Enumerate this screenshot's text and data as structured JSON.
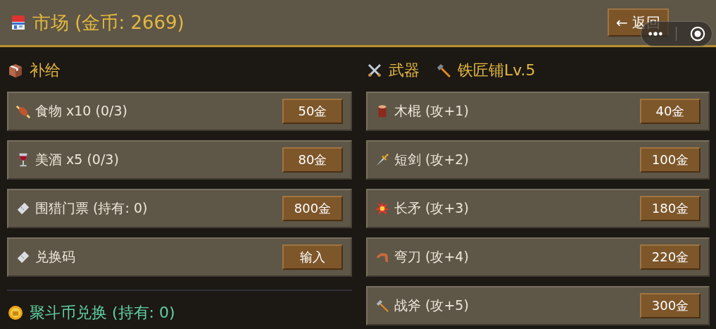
{
  "header": {
    "title": "市场 (金币: 2669)",
    "back_button": "← 返回"
  },
  "supplies": {
    "title": "补给",
    "items": [
      {
        "name": "食物 x10 (0/3)",
        "action": "50金"
      },
      {
        "name": "美酒 x5 (0/3)",
        "action": "80金"
      },
      {
        "name": "围猎门票 (持有: 0)",
        "action": "800金"
      },
      {
        "name": "兑换码",
        "action": "输入"
      }
    ]
  },
  "exchange": {
    "title": "聚斗币兑换 (持有: 0)"
  },
  "weapons": {
    "title": "武器",
    "smithy": "铁匠铺Lv.5",
    "items": [
      {
        "name": "木棍 (攻+1)",
        "action": "40金"
      },
      {
        "name": "短剑 (攻+2)",
        "action": "100金"
      },
      {
        "name": "长矛 (攻+3)",
        "action": "180金"
      },
      {
        "name": "弯刀 (攻+4)",
        "action": "220金"
      },
      {
        "name": "战斧 (攻+5)",
        "action": "300金"
      }
    ]
  }
}
